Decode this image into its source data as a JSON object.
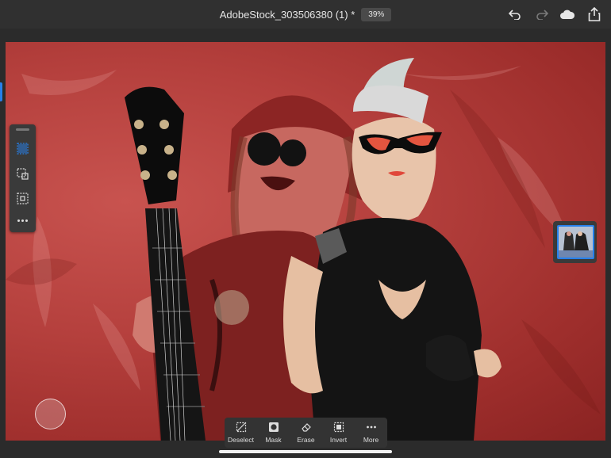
{
  "header": {
    "document_title": "AdobeStock_303506380 (1) *",
    "zoom_level": "39%",
    "undo_icon": "undo-icon",
    "redo_icon": "redo-icon",
    "cloud_icon": "cloud-icon",
    "share_icon": "share-icon"
  },
  "colors": {
    "accent": "#2680eb",
    "toolbar_bg": "#303030",
    "canvas_bg": "#b5403d"
  },
  "tool_panel": {
    "tools": [
      {
        "icon": "quick-select-icon",
        "active": true
      },
      {
        "icon": "rect-select-icon",
        "active": false
      },
      {
        "icon": "transform-select-icon",
        "active": false
      },
      {
        "icon": "more-icon",
        "active": false
      }
    ]
  },
  "bottom_toolbar": {
    "deselect_label": "Deselect",
    "mask_label": "Mask",
    "erase_label": "Erase",
    "invert_label": "Invert",
    "more_label": "More"
  }
}
